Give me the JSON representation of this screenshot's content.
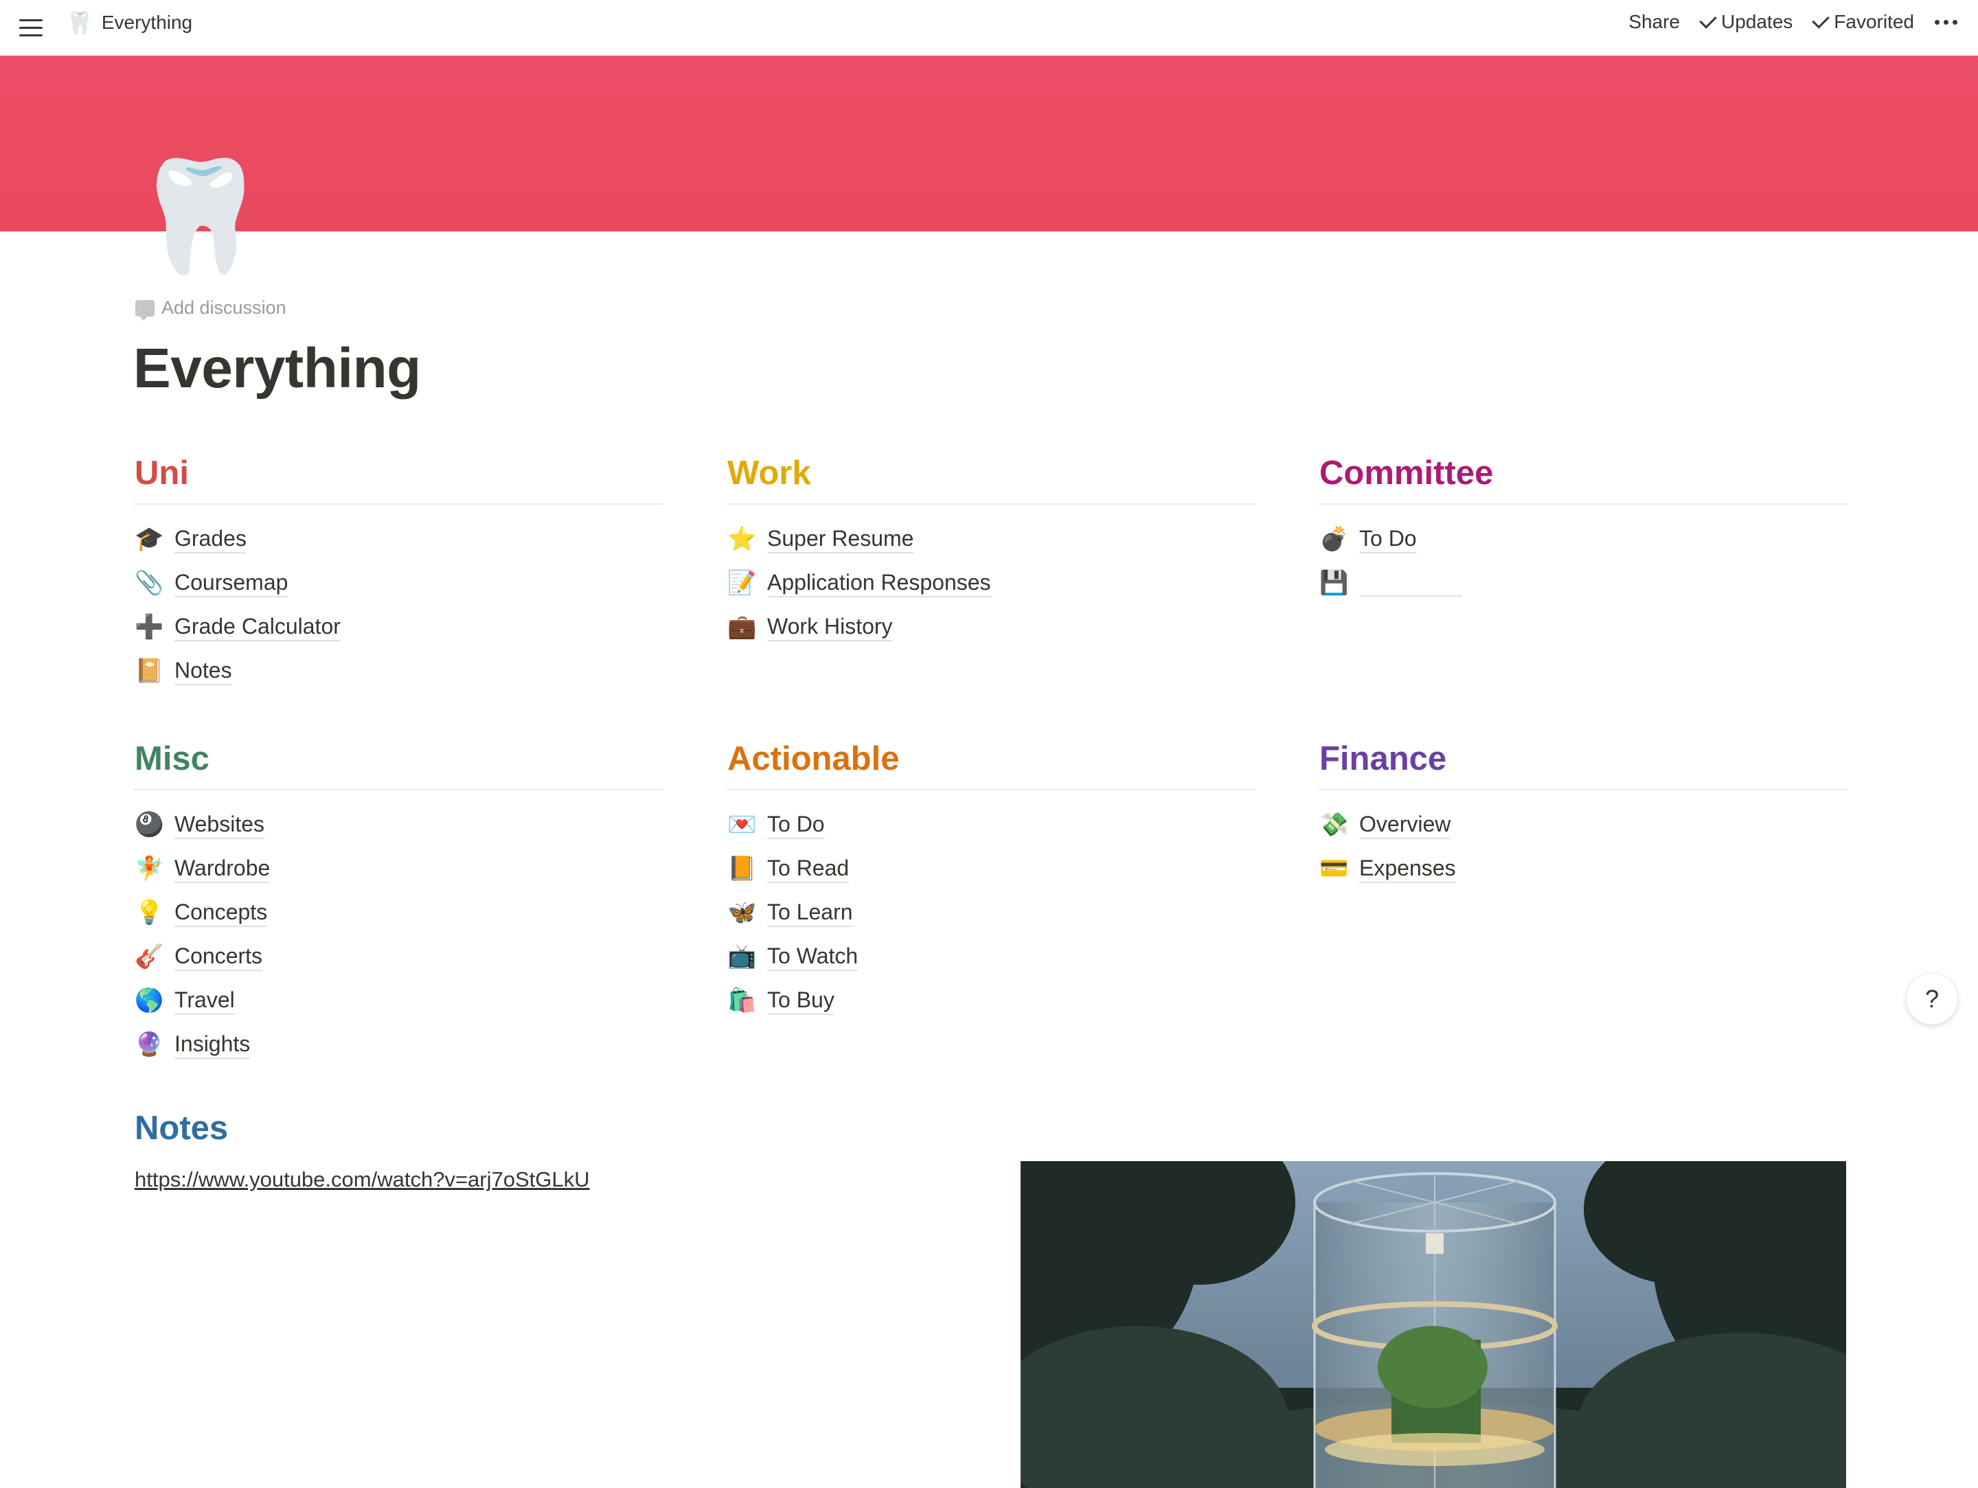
{
  "topbar": {
    "page_icon": "🦷",
    "page_title": "Everything",
    "share_label": "Share",
    "updates_label": "Updates",
    "favorited_label": "Favorited"
  },
  "page": {
    "icon": "🦷",
    "add_discussion": "Add discussion",
    "title": "Everything",
    "cover_color": "#ea4b62"
  },
  "sections": {
    "uni": {
      "title": "Uni",
      "color": "#d44c47",
      "items": [
        {
          "icon": "🎓",
          "label": "Grades"
        },
        {
          "icon": "📎",
          "label": "Coursemap"
        },
        {
          "icon": "➕",
          "label": "Grade Calculator"
        },
        {
          "icon": "📔",
          "label": "Notes"
        }
      ]
    },
    "work": {
      "title": "Work",
      "color": "#dfab01",
      "items": [
        {
          "icon": "⭐",
          "label": "Super Resume"
        },
        {
          "icon": "📝",
          "label": "Application Responses"
        },
        {
          "icon": "💼",
          "label": "Work History"
        }
      ]
    },
    "committee": {
      "title": "Committee",
      "color": "#ad1a72",
      "items": [
        {
          "icon": "💣",
          "label": "To Do"
        },
        {
          "icon": "💾",
          "label": ""
        }
      ]
    },
    "misc": {
      "title": "Misc",
      "color": "#448361",
      "items": [
        {
          "icon": "🎱",
          "label": "Websites"
        },
        {
          "icon": "🧚",
          "label": "Wardrobe"
        },
        {
          "icon": "💡",
          "label": "Concepts"
        },
        {
          "icon": "🎸",
          "label": "Concerts"
        },
        {
          "icon": "🌎",
          "label": "Travel"
        },
        {
          "icon": "🔮",
          "label": "Insights"
        }
      ]
    },
    "actionable": {
      "title": "Actionable",
      "color": "#d9730d",
      "items": [
        {
          "icon": "💌",
          "label": "To Do"
        },
        {
          "icon": "📙",
          "label": "To Read"
        },
        {
          "icon": "🦋",
          "label": "To Learn"
        },
        {
          "icon": "📺",
          "label": "To Watch"
        },
        {
          "icon": "🛍️",
          "label": "To Buy"
        }
      ]
    },
    "finance": {
      "title": "Finance",
      "color": "#6940a5",
      "items": [
        {
          "icon": "💸",
          "label": "Overview"
        },
        {
          "icon": "💳",
          "label": "Expenses"
        }
      ]
    }
  },
  "notes": {
    "title": "Notes",
    "link": "https://www.youtube.com/watch?v=arj7oStGLkU"
  },
  "help": {
    "label": "?"
  }
}
